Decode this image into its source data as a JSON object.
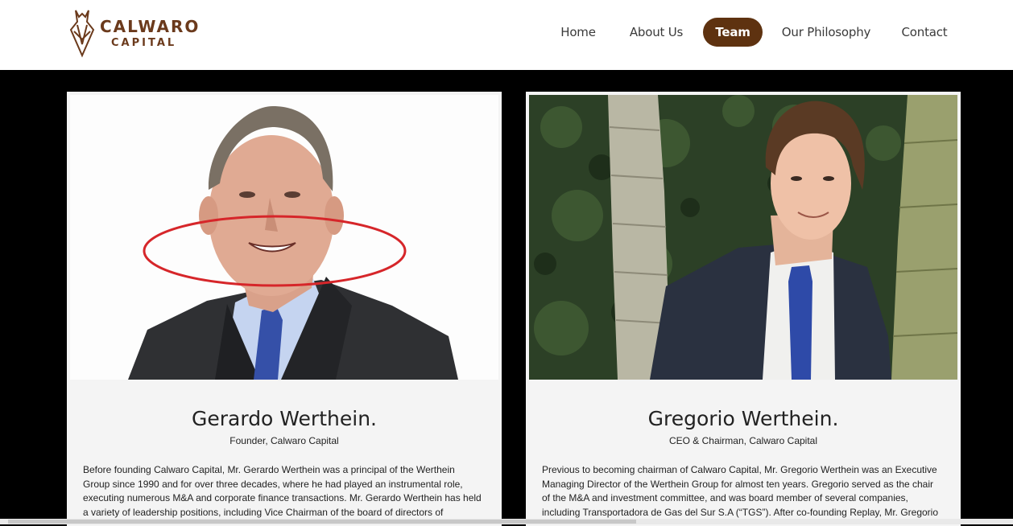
{
  "header": {
    "logo": {
      "line1": "CALWARO",
      "line2": "CAPITAL"
    },
    "nav": [
      {
        "label": "Home"
      },
      {
        "label": "About Us"
      },
      {
        "label": "Team",
        "active": true
      },
      {
        "label": "Our Philosophy"
      },
      {
        "label": "Contact"
      }
    ]
  },
  "colors": {
    "brand": "#5e3210",
    "annotation": "#d6262a"
  },
  "team": [
    {
      "name": "Gerardo Werthein.",
      "role": "Founder, Calwaro Capital",
      "bio": "Before founding Calwaro Capital, Mr. Gerardo Werthein was a principal of the Werthein Group since 1990 and for over three decades, where he had played an instrumental role, executing numerous M&A and corporate finance transactions. Mr. Gerardo Werthein has held a variety of leadership positions, including Vice Chairman of the board of directors of"
    },
    {
      "name": "Gregorio Werthein.",
      "role": "CEO & Chairman, Calwaro Capital",
      "bio": "Previous to becoming chairman of Calwaro Capital, Mr. Gregorio Werthein was an Executive Managing Director of the Werthein Group for almost ten years. Gregorio served as the chair of the M&A and investment committee, and was board member of several companies, including Transportadora de Gas del Sur S.A (“TGS”). After co-founding Replay, Mr. Gregorio"
    }
  ]
}
